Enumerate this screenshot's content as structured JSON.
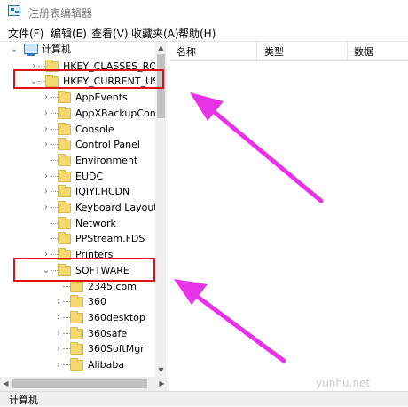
{
  "window": {
    "title": "注册表编辑器",
    "menu": [
      "文件(F)",
      "编辑(E)",
      "查看(V)",
      "收藏夹(A)",
      "帮助(H)"
    ]
  },
  "tree": {
    "root": "计算机",
    "items": [
      {
        "label": "HKEY_CLASSES_ROOT",
        "expander": "›"
      },
      {
        "label": "HKEY_CURRENT_USER",
        "expander": "⌄"
      },
      {
        "label": "AppEvents",
        "expander": "›"
      },
      {
        "label": "AppXBackupConter",
        "expander": "›"
      },
      {
        "label": "Console",
        "expander": "›"
      },
      {
        "label": "Control Panel",
        "expander": "›"
      },
      {
        "label": "Environment",
        "expander": ""
      },
      {
        "label": "EUDC",
        "expander": "›"
      },
      {
        "label": "IQIYI.HCDN",
        "expander": "›"
      },
      {
        "label": "Keyboard Layout",
        "expander": "›"
      },
      {
        "label": "Network",
        "expander": ""
      },
      {
        "label": "PPStream.FDS",
        "expander": ""
      },
      {
        "label": "Printers",
        "expander": "›"
      },
      {
        "label": "SOFTWARE",
        "expander": "⌄"
      },
      {
        "label": "2345.com",
        "expander": ""
      },
      {
        "label": "360",
        "expander": "›"
      },
      {
        "label": "360desktop",
        "expander": "›"
      },
      {
        "label": "360safe",
        "expander": "›"
      },
      {
        "label": "360SoftMgr",
        "expander": "›"
      },
      {
        "label": "Alibaba",
        "expander": "›"
      }
    ]
  },
  "list": {
    "columns": [
      "名称",
      "类型",
      "数据"
    ]
  },
  "statusbar": {
    "text": "计算机"
  },
  "watermark": "yunhu.net",
  "annotations": {
    "box_color": "#e0121a",
    "arrow_color": "#e832e8"
  }
}
